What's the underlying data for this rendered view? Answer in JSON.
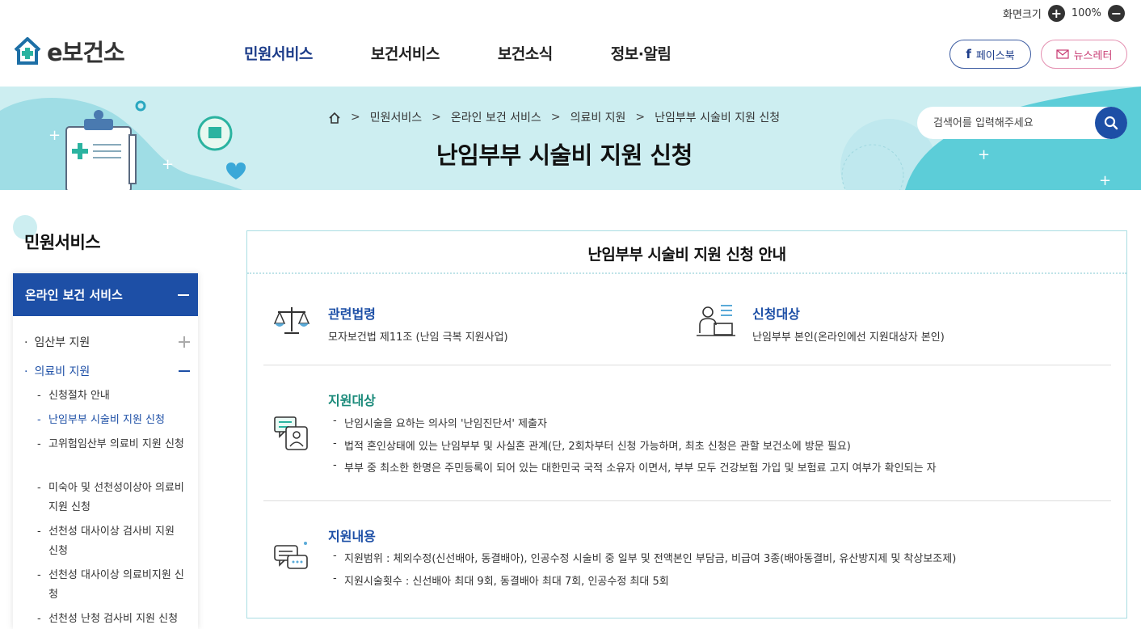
{
  "util": {
    "zoom_label": "화면크기",
    "zoom_value": "100%"
  },
  "logo": {
    "text": "e보건소"
  },
  "nav": {
    "items": [
      "민원서비스",
      "보건서비스",
      "보건소식",
      "정보·알림"
    ]
  },
  "sns": {
    "facebook": "페이스북",
    "newsletter": "뉴스레터"
  },
  "breadcrumb": {
    "items": [
      "민원서비스",
      "온라인 보건 서비스",
      "의료비 지원",
      "난임부부 시술비 지원 신청"
    ]
  },
  "page_title": "난임부부 시술비 지원 신청",
  "search": {
    "placeholder": "검색어를 입력해주세요"
  },
  "sidebar": {
    "title": "민원서비스",
    "group": "온라인 보건 서비스",
    "l2": [
      "임산부 지원",
      "의료비 지원"
    ],
    "l3": [
      "신청절차 안내",
      "난임부부 시술비 지원 신청",
      "고위험임산부 의료비 지원 신청",
      "미숙아 및 선천성이상아 의료비 지원 신청",
      "선천성 대사이상 검사비 지원 신청",
      "선천성 대사이상 의료비지원 신청",
      "선천성 난청 검사비 지원 신청"
    ]
  },
  "panel": {
    "title": "난임부부 시술비 지원 신청 안내",
    "law": {
      "heading": "관련법령",
      "text": "모자보건법 제11조 (난임 극복 지원사업)"
    },
    "applicant": {
      "heading": "신청대상",
      "text": "난임부부 본인(온라인에선 지원대상자 본인)"
    },
    "target": {
      "heading": "지원대상",
      "items": [
        "난임시술을 요하는 의사의 '난임진단서' 제출자",
        "법적 혼인상태에 있는 난임부부 및 사실혼 관계(단, 2회차부터 신청 가능하며, 최초 신청은 관할 보건소에 방문 필요)",
        "부부 중 최소한 한명은 주민등록이 되어 있는 대한민국 국적 소유자 이면서, 부부 모두 건강보험 가입 및 보험료 고지 여부가 확인되는 자"
      ]
    },
    "content": {
      "heading": "지원내용",
      "items": [
        "지원범위 : 체외수정(신선배아, 동결배아), 인공수정 시술비 중 일부 및 전액본인 부담금, 비급여 3종(배아동결비, 유산방지제 및 착상보조제)",
        "지원시술횟수 : 신선배아 최대 9회, 동결배아 최대 7회, 인공수정 최대 5회"
      ]
    }
  },
  "colors": {
    "primary": "#1d4fa6",
    "banner": "#cdeef1",
    "green": "#1a8a7a"
  }
}
